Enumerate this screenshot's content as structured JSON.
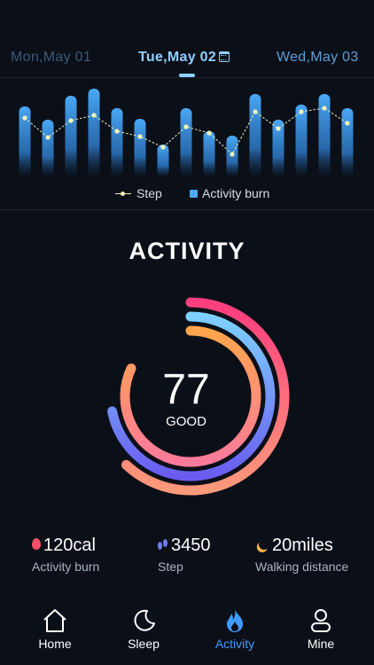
{
  "dates": {
    "previous": "Mon,May 01",
    "current": "Tue,May 02",
    "next": "Wed,May 03"
  },
  "chart_data": {
    "type": "bar",
    "series": [
      {
        "name": "Activity burn",
        "values": [
          80,
          65,
          92,
          100,
          78,
          66,
          37,
          78,
          52,
          47,
          94,
          65,
          82,
          94,
          78
        ]
      },
      {
        "name": "Step",
        "values": [
          67,
          45,
          64,
          70,
          52,
          46,
          34,
          57,
          50,
          26,
          74,
          55,
          74,
          78,
          61
        ]
      }
    ],
    "colors": {
      "bar": "#4aa8f5",
      "line": "#f0f3b8"
    },
    "legend": "bottom",
    "grid": false
  },
  "legend": {
    "step": "Step",
    "burn": "Activity burn"
  },
  "activity": {
    "title": "ACTIVITY",
    "score": "77",
    "rating": "GOOD",
    "rings": [
      {
        "name": "outer",
        "fraction": 0.62,
        "from": "#ff3d7f",
        "to": "#ff9a7a"
      },
      {
        "name": "middle",
        "fraction": 0.72,
        "from": "#7dd1ff",
        "to": "#6a5cf0"
      },
      {
        "name": "inner",
        "fraction": 0.82,
        "from": "#ffa64d",
        "to": "#ff7a9a"
      }
    ]
  },
  "stats": {
    "burn": {
      "value": "120cal",
      "label": "Activity burn",
      "icon": "flame-icon"
    },
    "step": {
      "value": "3450",
      "label": "Step",
      "icon": "footsteps-icon"
    },
    "distance": {
      "value": "20miles",
      "label": "Walking distance",
      "icon": "moon-icon"
    }
  },
  "nav": {
    "home": "Home",
    "sleep": "Sleep",
    "activity": "Activity",
    "mine": "Mine"
  },
  "colors": {
    "background": "#0b0f18",
    "accent": "#3f9bff"
  }
}
